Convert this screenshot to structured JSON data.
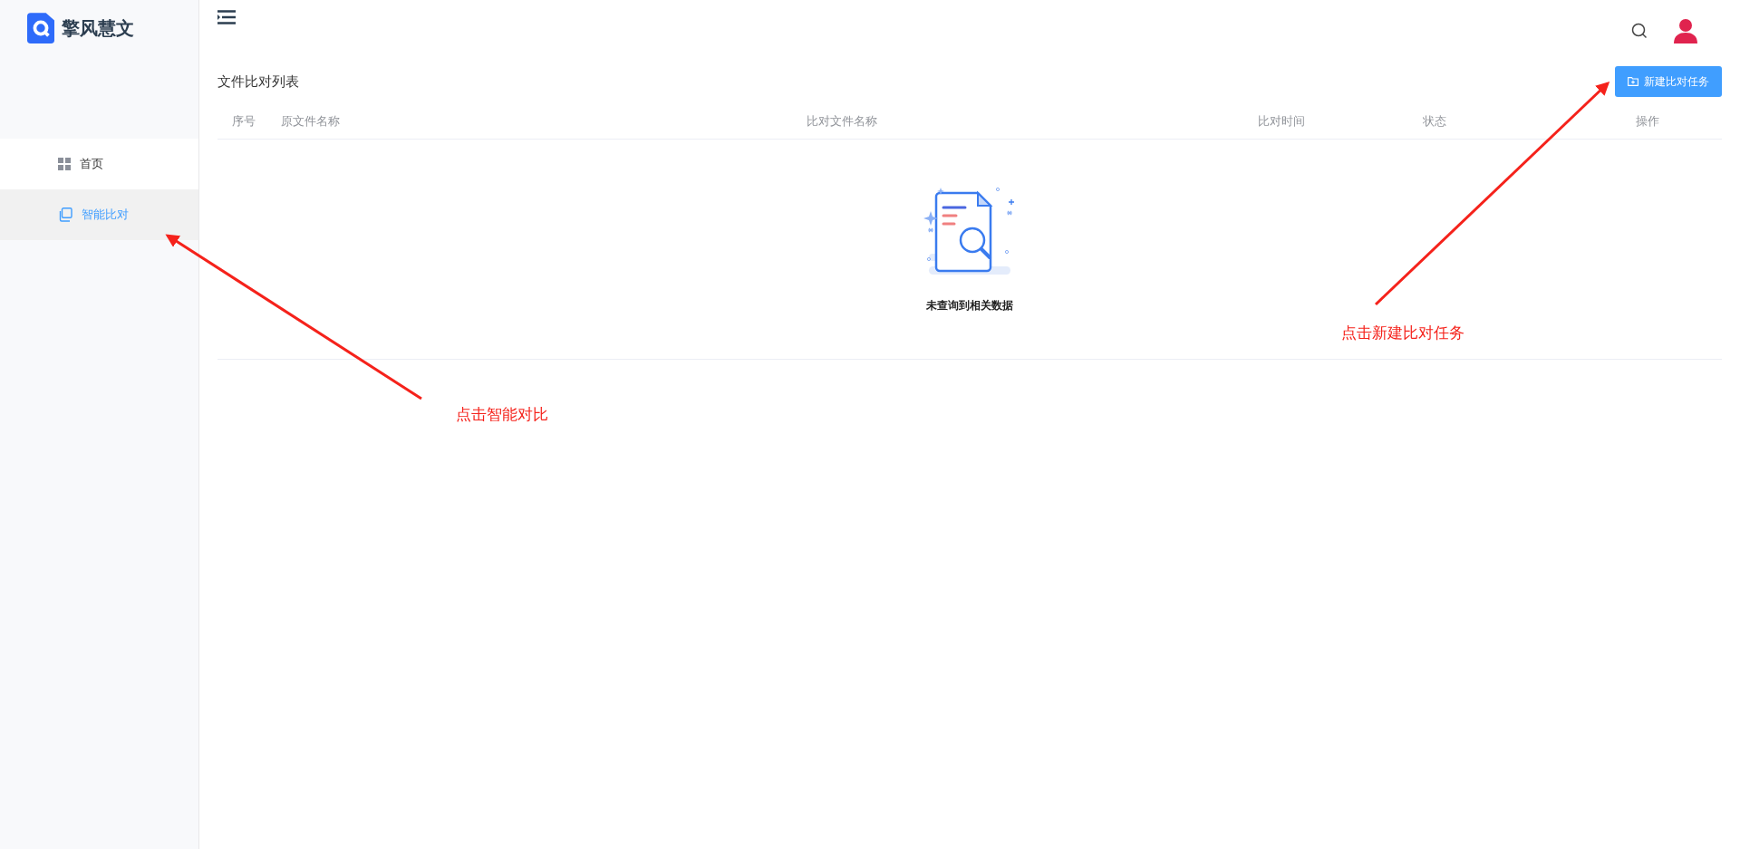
{
  "brand": {
    "name": "擎风慧文"
  },
  "sidebar": {
    "items": [
      {
        "label": "首页",
        "kind": "grid",
        "selected": false
      },
      {
        "label": "智能比对",
        "kind": "copy",
        "selected": true
      }
    ]
  },
  "page": {
    "title": "文件比对列表",
    "new_button": "新建比对任务"
  },
  "table": {
    "columns": [
      "序号",
      "原文件名称",
      "比对文件名称",
      "比对时间",
      "状态",
      "操作"
    ],
    "empty_text": "未查询到相关数据"
  },
  "annotations": [
    {
      "text": "点击智能对比",
      "kind": "sidebar"
    },
    {
      "text": "点击新建比对任务",
      "kind": "button"
    }
  ]
}
